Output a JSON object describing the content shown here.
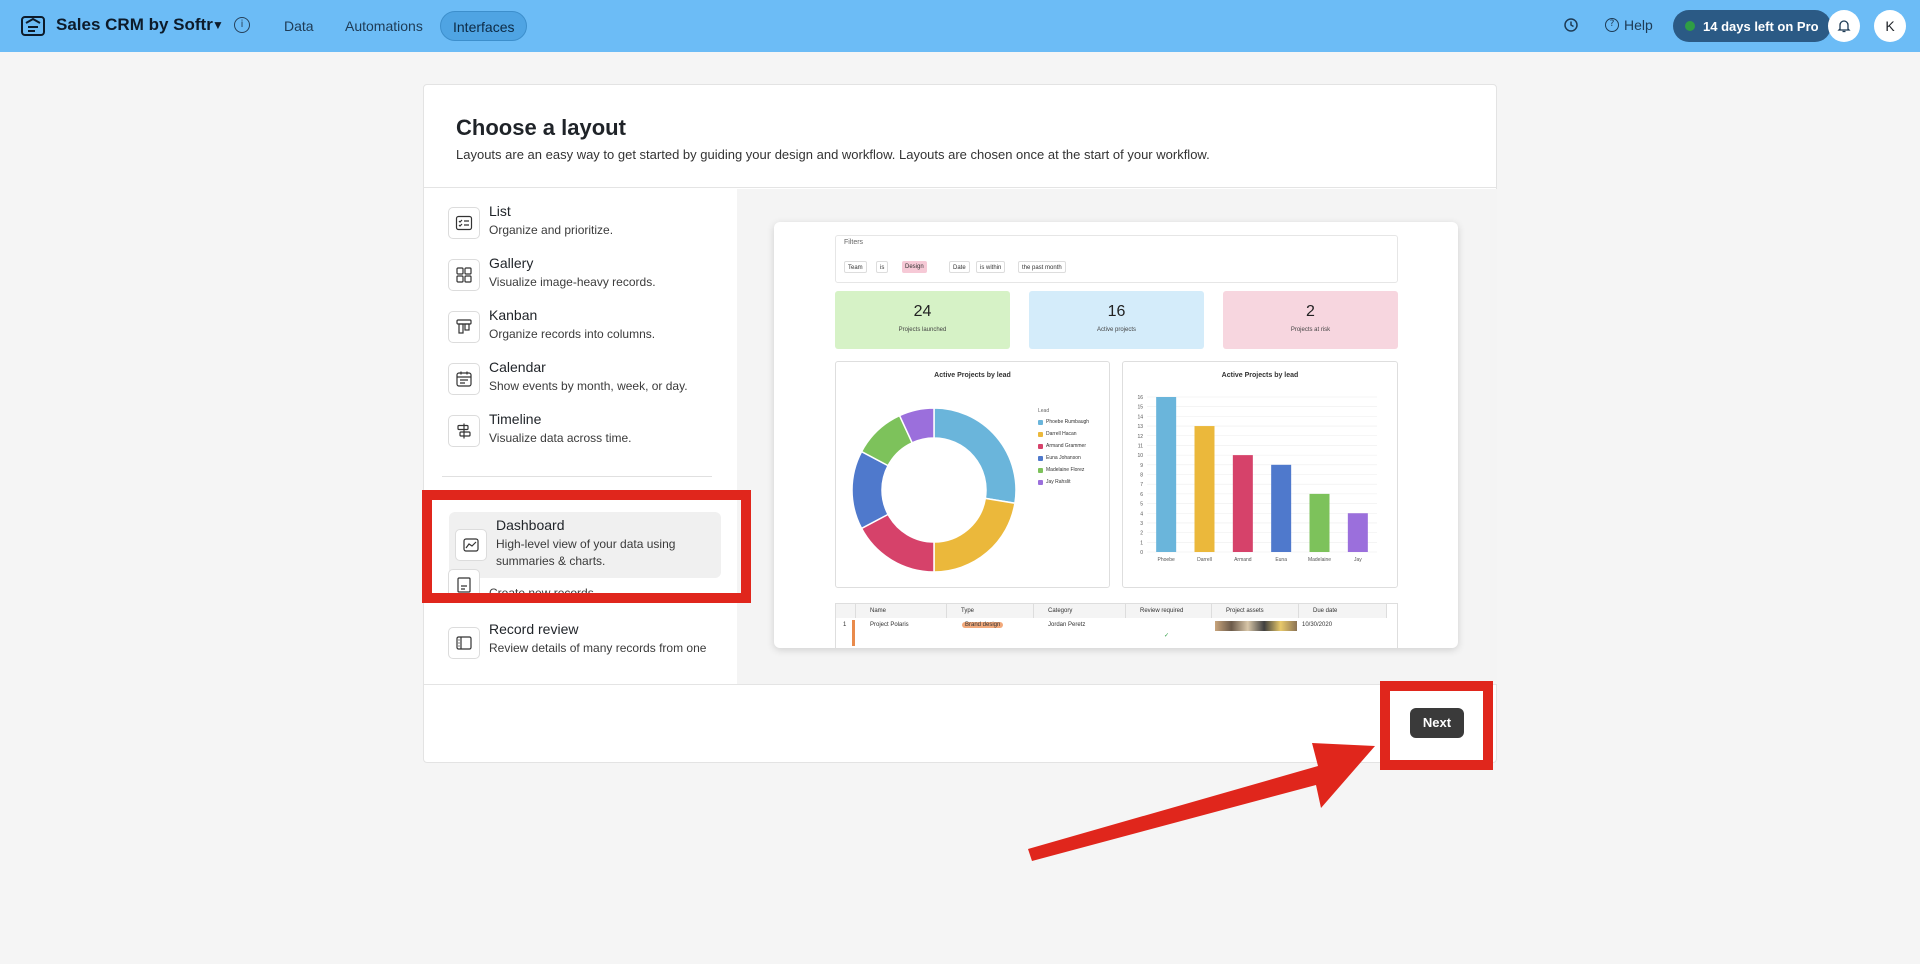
{
  "topbar": {
    "app_title": "Sales CRM by Softr",
    "nav": [
      "Data",
      "Automations",
      "Interfaces"
    ],
    "help_label": "Help",
    "trial_label": "14 days left on Pro",
    "avatar_initial": "K",
    "icons": [
      "app-logo-icon",
      "chevron-down-icon",
      "info-icon",
      "history-icon",
      "help-icon",
      "bell-icon"
    ]
  },
  "modal": {
    "title": "Choose a layout",
    "subtitle": "Layouts are an easy way to get started by guiding your design and workflow. Layouts are chosen once at the start of your workflow.",
    "layouts": [
      {
        "name": "List",
        "desc": "Organize and prioritize.",
        "icon": "list-icon"
      },
      {
        "name": "Gallery",
        "desc": "Visualize image-heavy records.",
        "icon": "gallery-icon"
      },
      {
        "name": "Kanban",
        "desc": "Organize records into columns.",
        "icon": "kanban-icon"
      },
      {
        "name": "Calendar",
        "desc": "Show events by month, week, or day.",
        "icon": "calendar-icon"
      },
      {
        "name": "Timeline",
        "desc": "Visualize data across time.",
        "icon": "timeline-icon"
      }
    ],
    "selected": {
      "name": "Dashboard",
      "desc": "High-level view of your data using summaries & charts.",
      "icon": "dashboard-icon"
    },
    "form_desc": "Create new records.",
    "record_review": {
      "name": "Record review",
      "desc": "Review details of many records from one"
    },
    "next_label": "Next"
  },
  "preview": {
    "filters_label": "Filters",
    "chips": [
      "Team",
      "is",
      "Design",
      "Date",
      "is within",
      "the past month"
    ],
    "kpis": [
      {
        "value": "24",
        "label": "Projects launched",
        "color": "#d6f2c6"
      },
      {
        "value": "16",
        "label": "Active projects",
        "color": "#d4ecfa"
      },
      {
        "value": "2",
        "label": "Projects at risk",
        "color": "#f7d6df"
      }
    ],
    "donut_title": "Active Projects by lead",
    "bar_title": "Active Projects by lead",
    "legend_title": "Lead",
    "leads": [
      {
        "name": "Phoebe Rumbaugh",
        "short": "Phoebe",
        "value": 16,
        "color": "#6ab5db"
      },
      {
        "name": "Darrell Hacan",
        "short": "Darrell",
        "value": 13,
        "color": "#ebb83b"
      },
      {
        "name": "Armand Grammer",
        "short": "Armand",
        "value": 10,
        "color": "#d6426a"
      },
      {
        "name": "Euna Johanson",
        "short": "Euna",
        "value": 9,
        "color": "#4f79cc"
      },
      {
        "name": "Madelaine Florez",
        "short": "Madelaine",
        "value": 6,
        "color": "#7dc25b"
      },
      {
        "name": "Jay Rahslit",
        "short": "Jay",
        "value": 4,
        "color": "#9b6fdc"
      }
    ],
    "table": {
      "headers": [
        "Name",
        "Type",
        "Category",
        "Review required",
        "Project assets",
        "Due date"
      ],
      "row": {
        "index": "1",
        "name": "Project Polaris",
        "type": "Brand design",
        "category": "Jordan Peretz",
        "check": "✓",
        "due": "10/30/2020"
      }
    }
  },
  "chart_data": {
    "type": "bar",
    "title": "Active Projects by lead",
    "categories": [
      "Phoebe",
      "Darrell",
      "Armand",
      "Euna",
      "Madelaine",
      "Jay"
    ],
    "values": [
      16,
      13,
      10,
      9,
      6,
      4
    ],
    "ylim": [
      0,
      16
    ],
    "y_ticks": [
      0,
      1,
      2,
      3,
      4,
      5,
      6,
      7,
      8,
      9,
      10,
      11,
      12,
      13,
      14,
      15,
      16
    ],
    "colors": [
      "#6ab5db",
      "#ebb83b",
      "#d6426a",
      "#4f79cc",
      "#7dc25b",
      "#9b6fdc"
    ],
    "grid": true
  },
  "annotations": {
    "color": "#e0261c"
  }
}
